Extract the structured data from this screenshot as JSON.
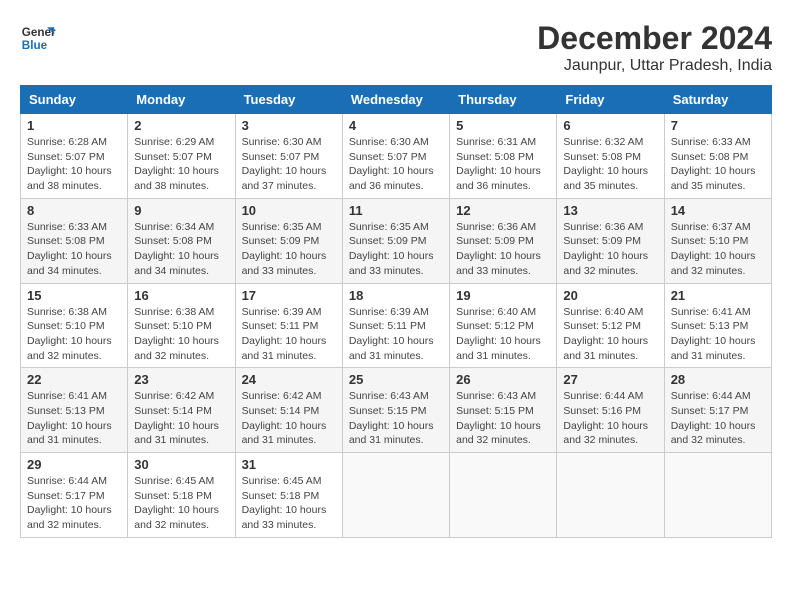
{
  "logo": {
    "line1": "General",
    "line2": "Blue"
  },
  "title": "December 2024",
  "subtitle": "Jaunpur, Uttar Pradesh, India",
  "weekdays": [
    "Sunday",
    "Monday",
    "Tuesday",
    "Wednesday",
    "Thursday",
    "Friday",
    "Saturday"
  ],
  "weeks": [
    [
      {
        "day": "1",
        "info": "Sunrise: 6:28 AM\nSunset: 5:07 PM\nDaylight: 10 hours\nand 38 minutes."
      },
      {
        "day": "2",
        "info": "Sunrise: 6:29 AM\nSunset: 5:07 PM\nDaylight: 10 hours\nand 38 minutes."
      },
      {
        "day": "3",
        "info": "Sunrise: 6:30 AM\nSunset: 5:07 PM\nDaylight: 10 hours\nand 37 minutes."
      },
      {
        "day": "4",
        "info": "Sunrise: 6:30 AM\nSunset: 5:07 PM\nDaylight: 10 hours\nand 36 minutes."
      },
      {
        "day": "5",
        "info": "Sunrise: 6:31 AM\nSunset: 5:08 PM\nDaylight: 10 hours\nand 36 minutes."
      },
      {
        "day": "6",
        "info": "Sunrise: 6:32 AM\nSunset: 5:08 PM\nDaylight: 10 hours\nand 35 minutes."
      },
      {
        "day": "7",
        "info": "Sunrise: 6:33 AM\nSunset: 5:08 PM\nDaylight: 10 hours\nand 35 minutes."
      }
    ],
    [
      {
        "day": "8",
        "info": "Sunrise: 6:33 AM\nSunset: 5:08 PM\nDaylight: 10 hours\nand 34 minutes."
      },
      {
        "day": "9",
        "info": "Sunrise: 6:34 AM\nSunset: 5:08 PM\nDaylight: 10 hours\nand 34 minutes."
      },
      {
        "day": "10",
        "info": "Sunrise: 6:35 AM\nSunset: 5:09 PM\nDaylight: 10 hours\nand 33 minutes."
      },
      {
        "day": "11",
        "info": "Sunrise: 6:35 AM\nSunset: 5:09 PM\nDaylight: 10 hours\nand 33 minutes."
      },
      {
        "day": "12",
        "info": "Sunrise: 6:36 AM\nSunset: 5:09 PM\nDaylight: 10 hours\nand 33 minutes."
      },
      {
        "day": "13",
        "info": "Sunrise: 6:36 AM\nSunset: 5:09 PM\nDaylight: 10 hours\nand 32 minutes."
      },
      {
        "day": "14",
        "info": "Sunrise: 6:37 AM\nSunset: 5:10 PM\nDaylight: 10 hours\nand 32 minutes."
      }
    ],
    [
      {
        "day": "15",
        "info": "Sunrise: 6:38 AM\nSunset: 5:10 PM\nDaylight: 10 hours\nand 32 minutes."
      },
      {
        "day": "16",
        "info": "Sunrise: 6:38 AM\nSunset: 5:10 PM\nDaylight: 10 hours\nand 32 minutes."
      },
      {
        "day": "17",
        "info": "Sunrise: 6:39 AM\nSunset: 5:11 PM\nDaylight: 10 hours\nand 31 minutes."
      },
      {
        "day": "18",
        "info": "Sunrise: 6:39 AM\nSunset: 5:11 PM\nDaylight: 10 hours\nand 31 minutes."
      },
      {
        "day": "19",
        "info": "Sunrise: 6:40 AM\nSunset: 5:12 PM\nDaylight: 10 hours\nand 31 minutes."
      },
      {
        "day": "20",
        "info": "Sunrise: 6:40 AM\nSunset: 5:12 PM\nDaylight: 10 hours\nand 31 minutes."
      },
      {
        "day": "21",
        "info": "Sunrise: 6:41 AM\nSunset: 5:13 PM\nDaylight: 10 hours\nand 31 minutes."
      }
    ],
    [
      {
        "day": "22",
        "info": "Sunrise: 6:41 AM\nSunset: 5:13 PM\nDaylight: 10 hours\nand 31 minutes."
      },
      {
        "day": "23",
        "info": "Sunrise: 6:42 AM\nSunset: 5:14 PM\nDaylight: 10 hours\nand 31 minutes."
      },
      {
        "day": "24",
        "info": "Sunrise: 6:42 AM\nSunset: 5:14 PM\nDaylight: 10 hours\nand 31 minutes."
      },
      {
        "day": "25",
        "info": "Sunrise: 6:43 AM\nSunset: 5:15 PM\nDaylight: 10 hours\nand 31 minutes."
      },
      {
        "day": "26",
        "info": "Sunrise: 6:43 AM\nSunset: 5:15 PM\nDaylight: 10 hours\nand 32 minutes."
      },
      {
        "day": "27",
        "info": "Sunrise: 6:44 AM\nSunset: 5:16 PM\nDaylight: 10 hours\nand 32 minutes."
      },
      {
        "day": "28",
        "info": "Sunrise: 6:44 AM\nSunset: 5:17 PM\nDaylight: 10 hours\nand 32 minutes."
      }
    ],
    [
      {
        "day": "29",
        "info": "Sunrise: 6:44 AM\nSunset: 5:17 PM\nDaylight: 10 hours\nand 32 minutes."
      },
      {
        "day": "30",
        "info": "Sunrise: 6:45 AM\nSunset: 5:18 PM\nDaylight: 10 hours\nand 32 minutes."
      },
      {
        "day": "31",
        "info": "Sunrise: 6:45 AM\nSunset: 5:18 PM\nDaylight: 10 hours\nand 33 minutes."
      },
      {
        "day": "",
        "info": ""
      },
      {
        "day": "",
        "info": ""
      },
      {
        "day": "",
        "info": ""
      },
      {
        "day": "",
        "info": ""
      }
    ]
  ]
}
